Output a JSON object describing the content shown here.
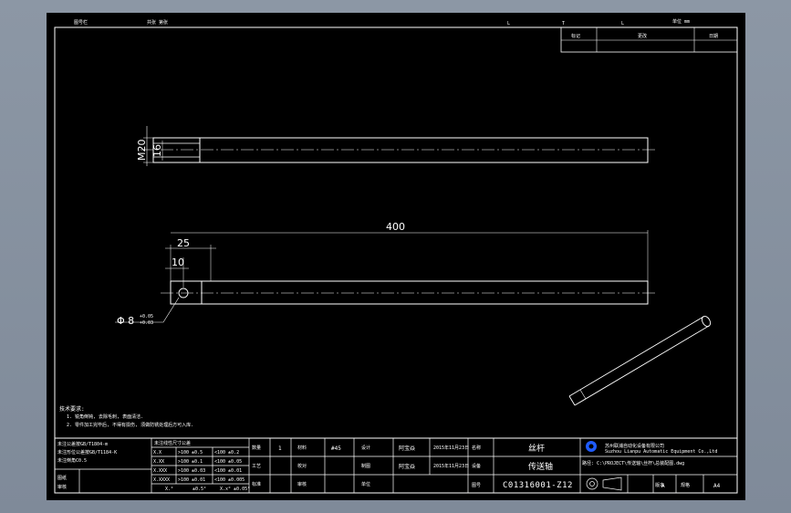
{
  "viewport": {
    "background": "#8c97a5",
    "sheet": "#000000",
    "line": "#ffffff",
    "logo": "#1f5cff"
  },
  "header_strip": {
    "left_label": "图号栏",
    "middle_label": "共张 第张",
    "marks": [
      "L",
      "T",
      "L",
      "单位 mm"
    ]
  },
  "revision_table": {
    "headers": [
      "标记",
      "更改",
      "日期"
    ]
  },
  "part_view_top": {
    "labels": {
      "diameter": "M20",
      "length": "16"
    }
  },
  "part_view_front": {
    "labels": {
      "overall": "400",
      "first": "25",
      "second": "10",
      "hole": "Φ 8",
      "tol_upper": "+0.05",
      "tol_lower": "+0.03"
    }
  },
  "notes": {
    "title": "技术要求:",
    "lines": [
      "1. 锐角倒钝, 去除毛刺, 表面清洁.",
      "2. 零件加工完毕后, 不得有损伤, 须做防锈处理后方可入库."
    ]
  },
  "tolerance_table": {
    "left_header": [
      "未注公差按GB/T1804-m",
      "未注形位公差按GB/T1184-K",
      "未注倒角C0.5"
    ],
    "right_header": "未注线性尺寸公差",
    "rows": [
      {
        "k": "X.X",
        "a": ">100 ±0.5",
        "b": "<100 ±0.2"
      },
      {
        "k": "X.XX",
        "a": ">100 ±0.1",
        "b": "<100 ±0.05"
      },
      {
        "k": "X.XXX",
        "a": ">100 ±0.03",
        "b": "<100 ±0.01"
      },
      {
        "k": "X.XXXX",
        "a": ">100 ±0.01",
        "b": "<100 ±0.005"
      },
      {
        "k": "X.°",
        "a": "±0.5°",
        "b": "X.x° ±0.05°"
      }
    ],
    "side_labels": [
      "图纸",
      "审核"
    ]
  },
  "title_block": {
    "qty_label": "数量",
    "qty_value": "1",
    "material_label": "材料",
    "material_value": "#45",
    "design_label": "设计",
    "designer": "阿宝焱",
    "date1": "2015年11月23日",
    "approve_label": "审核",
    "draw_label": "制图",
    "drafter": "阿宝焱",
    "date2": "2015年11月23日",
    "equip_label": "设备",
    "check_label": "校对",
    "std_label": "标准",
    "process_label": "工艺",
    "unit_label": "单位",
    "name_label": "名称",
    "part_name": "丝杆",
    "part_name2": "传送轴",
    "company": "苏州联浦自动化设备有限公司",
    "company_en": "Suzhou Lianpu Automatic Equipment Co.,Ltd",
    "path": "路径: C:\\PROJECT\\传送轴\\丝杆\\总装配图.dwg",
    "drawing_no_label": "图号",
    "drawing_no": "C01316001-Z12",
    "version_label": "版本",
    "version": "A",
    "size_label": "规格",
    "size": "A4"
  }
}
